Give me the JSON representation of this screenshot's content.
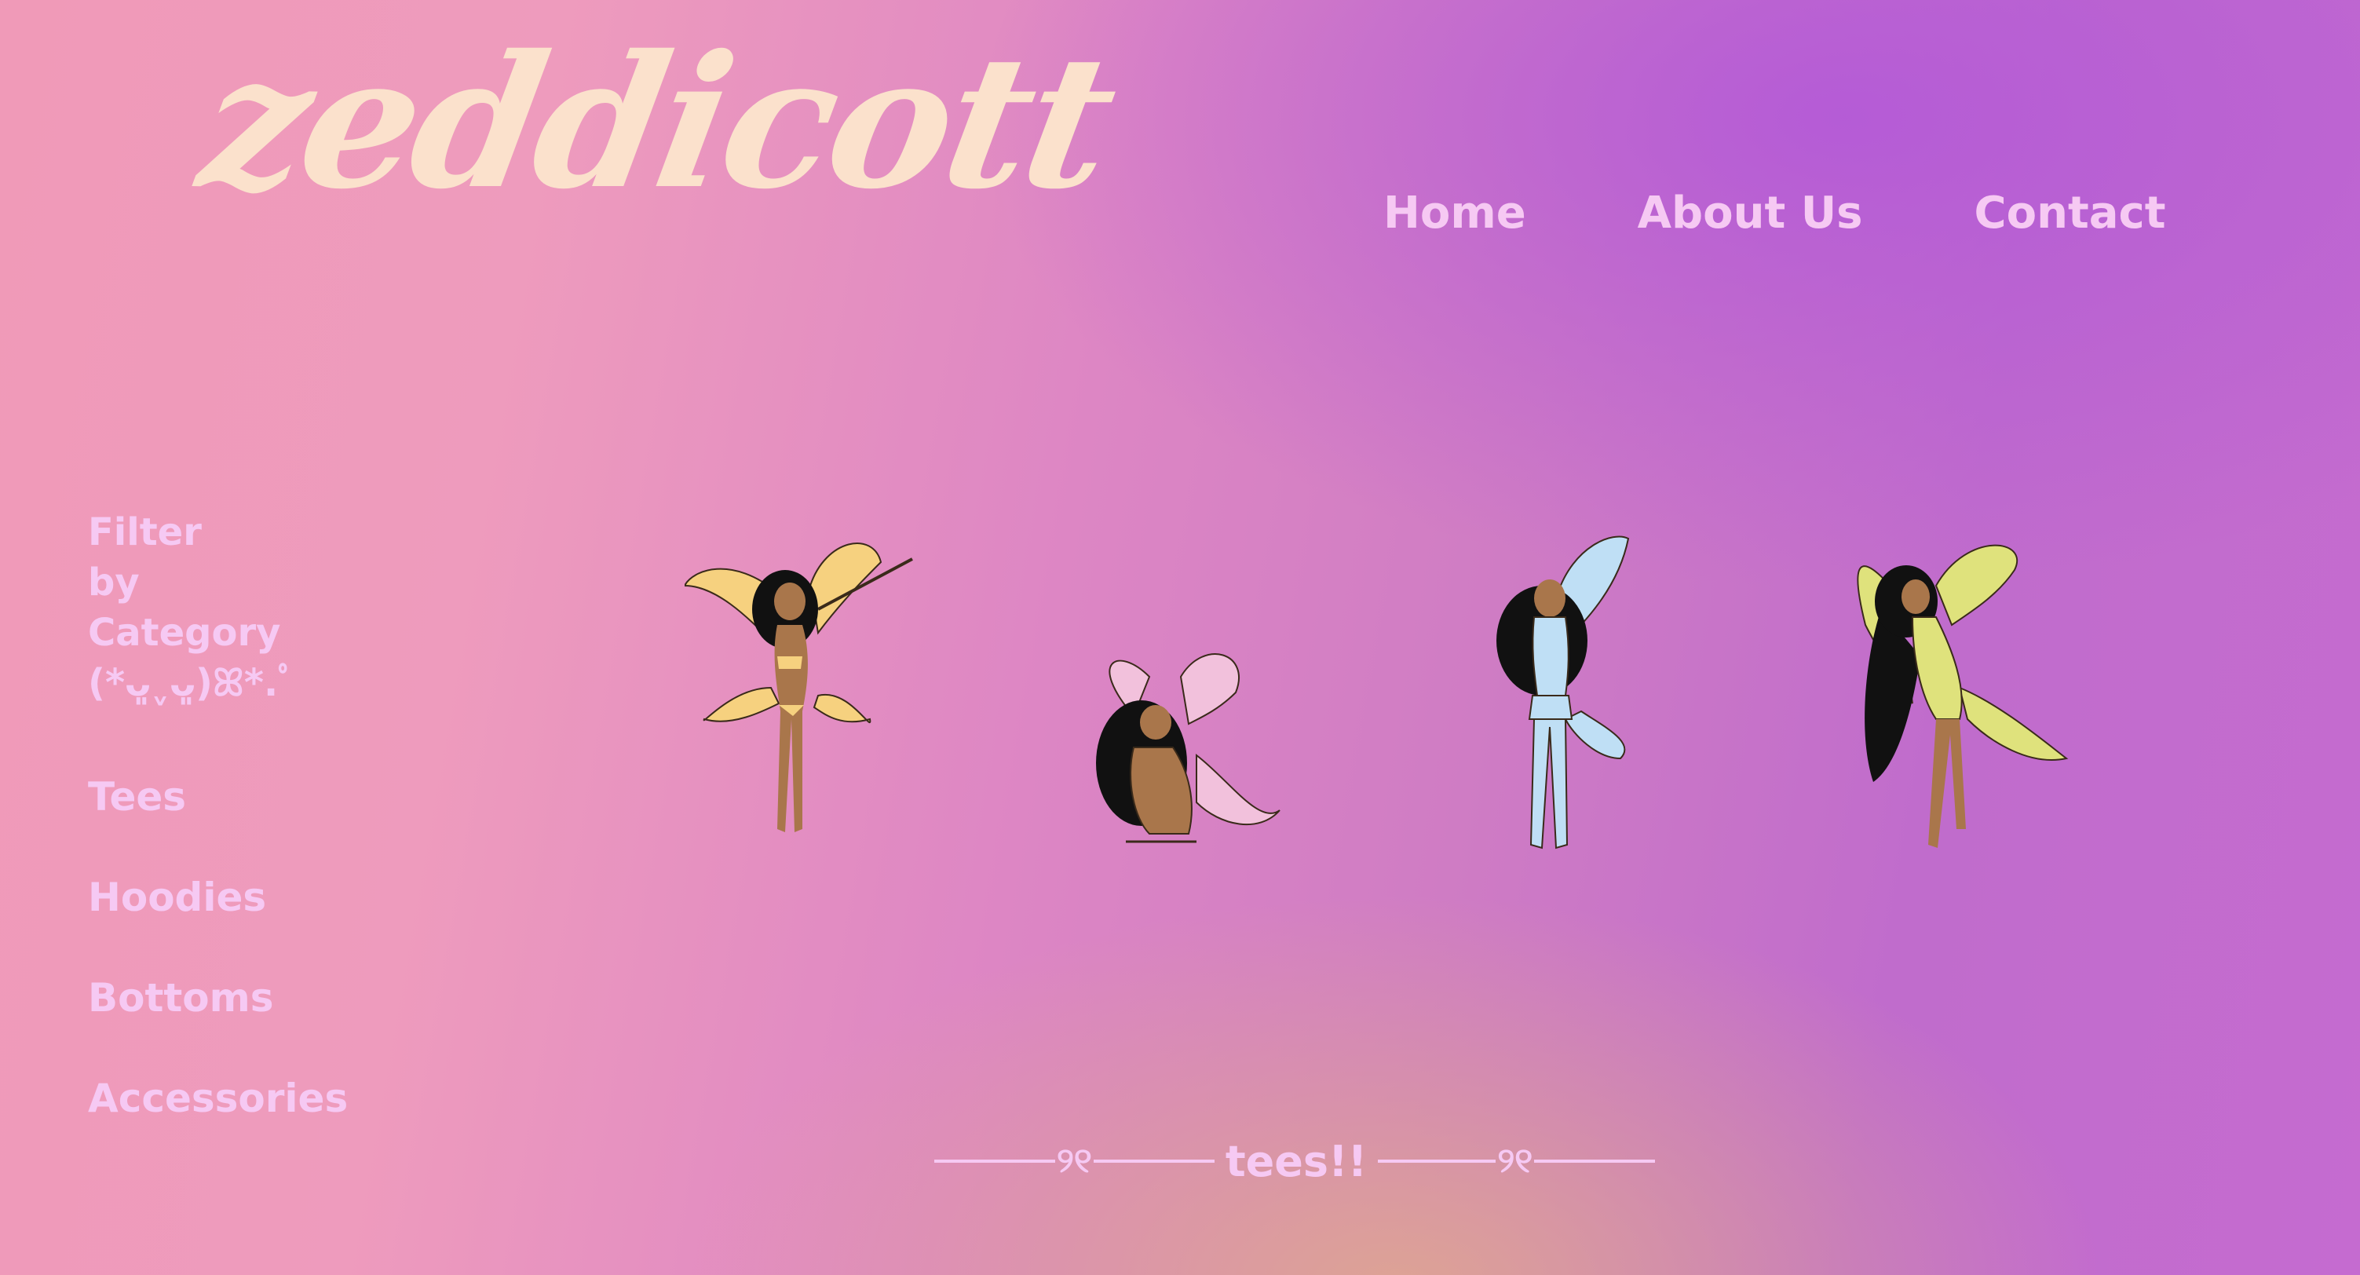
{
  "brand": {
    "logo_text": "zeddicott"
  },
  "nav": {
    "items": [
      "Home",
      "About Us",
      "Contact"
    ]
  },
  "filter": {
    "heading_lines": [
      "Filter",
      "by",
      "Category",
      "(*ᴗ͈ˬᴗ͈)ꕤ*.ﾟ"
    ],
    "categories": [
      "Tees",
      "Hoodies",
      "Bottoms",
      "Accessories"
    ]
  },
  "products": [
    {
      "name": "fairy-yellow-bikini",
      "wing_color": "#f6d17f"
    },
    {
      "name": "fairy-pink-sitting",
      "wing_color": "#f2c1dc"
    },
    {
      "name": "fairy-blue-outfit",
      "wing_color": "#bfdff5"
    },
    {
      "name": "fairy-green-outfit",
      "wing_color": "#dfe27c"
    }
  ],
  "section": {
    "title": "tees!!",
    "ornament": "୨୧"
  },
  "colors": {
    "accent_text": "#f6c9f3",
    "logo": "#fbe1cc",
    "bg_left": "#f09ab8",
    "bg_right": "#c06ccc"
  }
}
